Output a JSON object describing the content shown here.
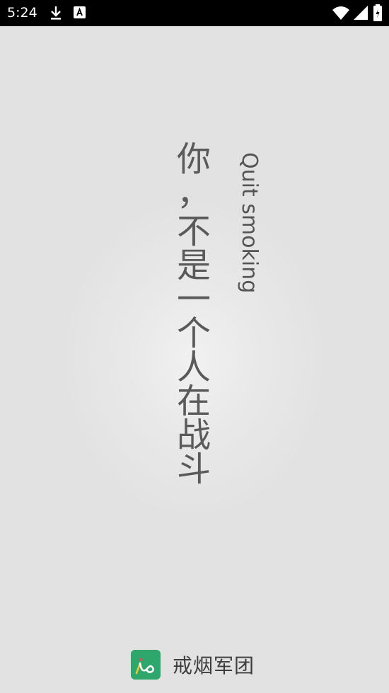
{
  "status_bar": {
    "time": "5:24",
    "icons": [
      "download-icon",
      "font-a-icon",
      "wifi-icon",
      "cellular-signal-icon",
      "battery-icon"
    ]
  },
  "splash": {
    "slogan_chars": [
      "你",
      "，",
      "不",
      "是",
      "一",
      "个",
      "人",
      "在",
      "战",
      "斗"
    ],
    "subtitle": "Quit smoking",
    "brand_name": "戒烟军团"
  },
  "colors": {
    "status_bar_bg": "#000000",
    "background": "#e3e3e3",
    "logo_green": "#2fa66b",
    "text": "#5a5a5a"
  }
}
